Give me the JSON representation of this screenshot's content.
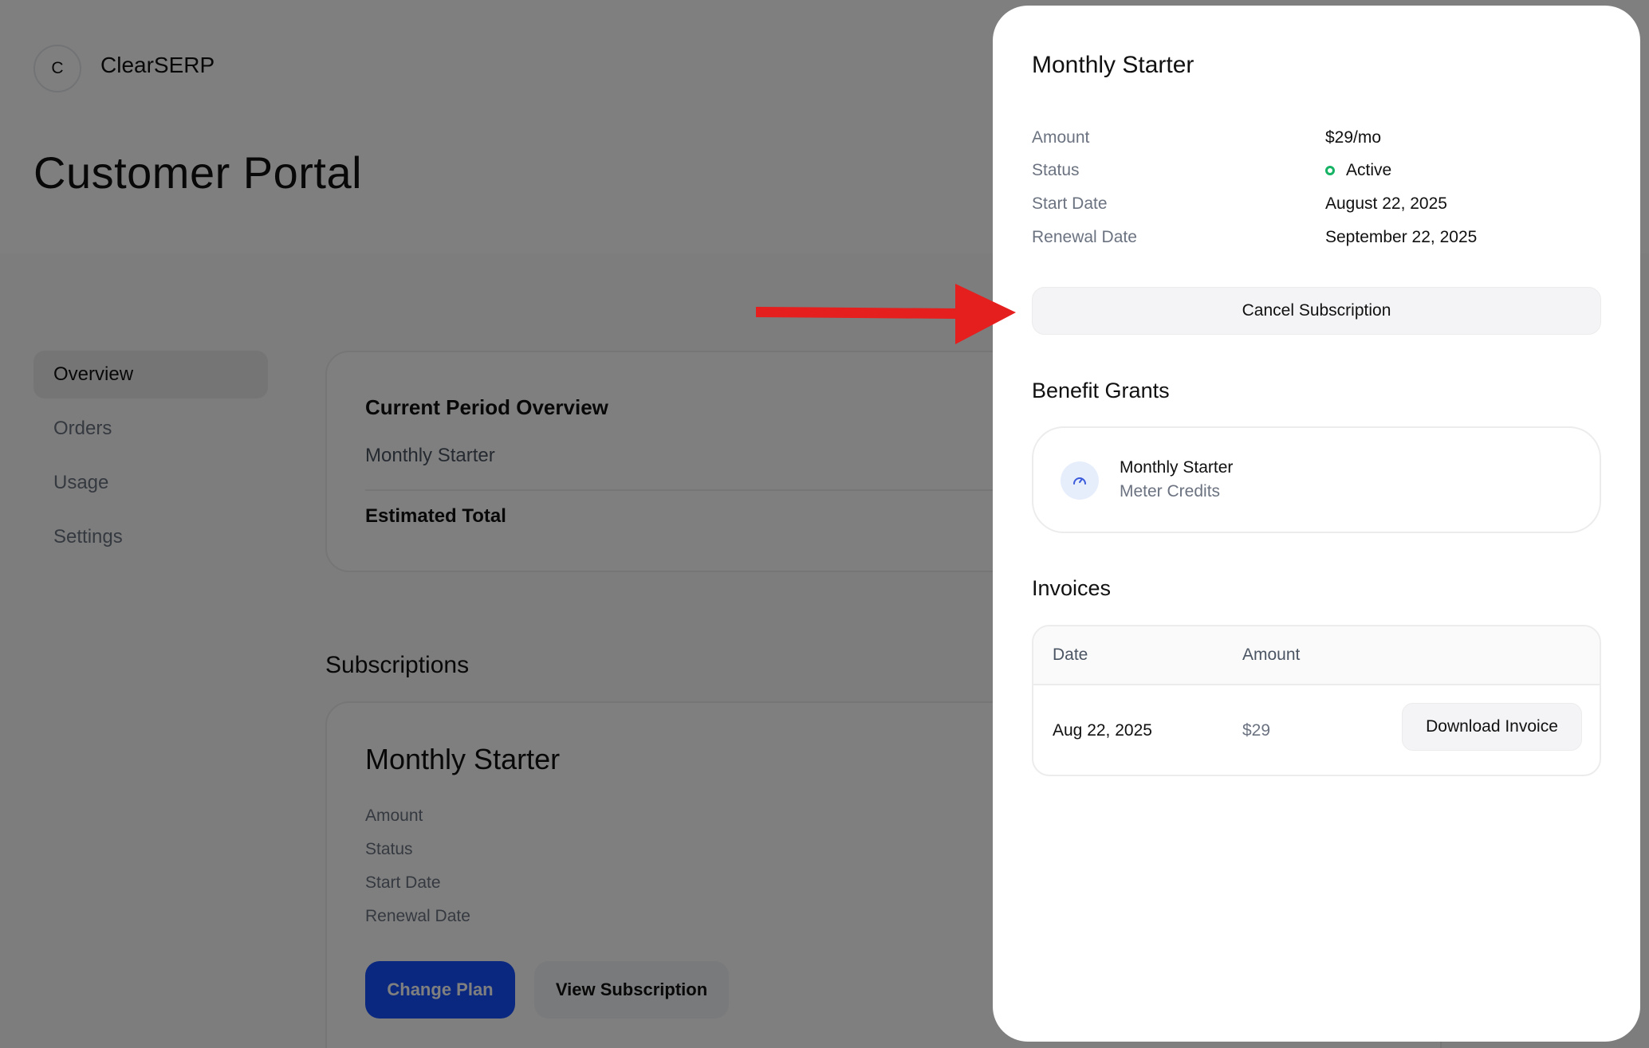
{
  "brand": {
    "initial": "C",
    "name": "ClearSERP"
  },
  "page_title": "Customer Portal",
  "nav": {
    "items": [
      "Overview",
      "Orders",
      "Usage",
      "Settings"
    ],
    "active": "Overview"
  },
  "current_period": {
    "title": "Current Period Overview",
    "plan": "Monthly Starter",
    "total_label": "Estimated Total"
  },
  "subscriptions": {
    "heading": "Subscriptions",
    "card": {
      "title": "Monthly Starter",
      "labels": [
        "Amount",
        "Status",
        "Start Date",
        "Renewal Date"
      ],
      "change_plan": "Change Plan",
      "view_subscription": "View Subscription"
    }
  },
  "panel": {
    "title": "Monthly Starter",
    "details": {
      "amount": {
        "label": "Amount",
        "value": "$29/mo"
      },
      "status": {
        "label": "Status",
        "value": "Active",
        "color": "#16b364"
      },
      "start_date": {
        "label": "Start Date",
        "value": "August 22, 2025"
      },
      "renewal_date": {
        "label": "Renewal Date",
        "value": "September 22, 2025"
      }
    },
    "cancel_button": "Cancel Subscription",
    "benefits": {
      "heading": "Benefit Grants",
      "items": [
        {
          "name": "Monthly Starter",
          "type": "Meter Credits",
          "icon": "gauge-icon"
        }
      ]
    },
    "invoices": {
      "heading": "Invoices",
      "columns": [
        "Date",
        "Amount"
      ],
      "rows": [
        {
          "date": "Aug 22, 2025",
          "amount": "$29",
          "action": "Download Invoice"
        }
      ]
    }
  },
  "annotation": {
    "icon": "red-arrow-icon",
    "color": "#e51e1e"
  },
  "colors": {
    "primary": "#1450ff",
    "overlay": "rgba(0,0,0,0.5)"
  }
}
